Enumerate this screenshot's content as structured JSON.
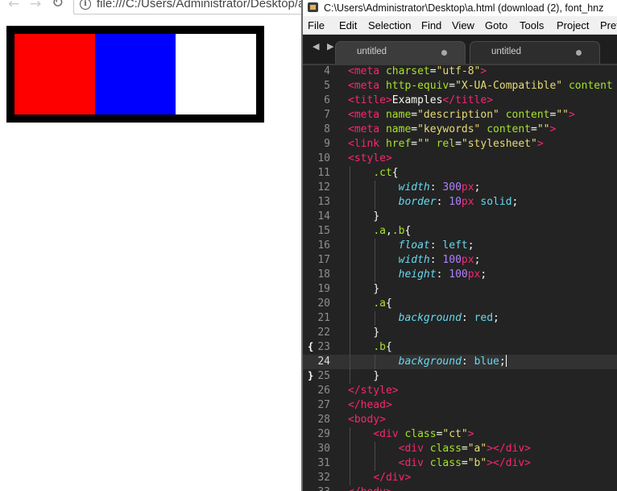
{
  "browser": {
    "address": "file:///C:/Users/Administrator/Desktop/a.html",
    "demo_colors": {
      "a": "#ff0000",
      "b": "#0000ff",
      "border": "#000000"
    }
  },
  "editor": {
    "title": "C:\\Users\\Administrator\\Desktop\\a.html (download (2), font_hnz",
    "menu": [
      "File",
      "Edit",
      "Selection",
      "Find",
      "View",
      "Goto",
      "Tools",
      "Project",
      "Pref"
    ],
    "tabs": [
      "untitled",
      "untitled"
    ],
    "current_line": 24,
    "lines": [
      {
        "n": 4,
        "indent": 0,
        "tokens": [
          [
            "tag",
            "<meta "
          ],
          [
            "attr",
            "charset"
          ],
          [
            "plain",
            "="
          ],
          [
            "str",
            "\"utf-8\""
          ],
          [
            "tag",
            ">"
          ]
        ]
      },
      {
        "n": 5,
        "indent": 0,
        "tokens": [
          [
            "tag",
            "<meta "
          ],
          [
            "attr",
            "http-equiv"
          ],
          [
            "plain",
            "="
          ],
          [
            "str",
            "\"X-UA-Compatible\""
          ],
          [
            "plain",
            " "
          ],
          [
            "attr",
            "content"
          ]
        ]
      },
      {
        "n": 6,
        "indent": 0,
        "tokens": [
          [
            "tag",
            "<title>"
          ],
          [
            "plain",
            "Examples"
          ],
          [
            "tag",
            "</title>"
          ]
        ]
      },
      {
        "n": 7,
        "indent": 0,
        "tokens": [
          [
            "tag",
            "<meta "
          ],
          [
            "attr",
            "name"
          ],
          [
            "plain",
            "="
          ],
          [
            "str",
            "\"description\""
          ],
          [
            "plain",
            " "
          ],
          [
            "attr",
            "content"
          ],
          [
            "plain",
            "="
          ],
          [
            "str",
            "\"\""
          ],
          [
            "tag",
            ">"
          ]
        ]
      },
      {
        "n": 8,
        "indent": 0,
        "tokens": [
          [
            "tag",
            "<meta "
          ],
          [
            "attr",
            "name"
          ],
          [
            "plain",
            "="
          ],
          [
            "str",
            "\"keywords\""
          ],
          [
            "plain",
            " "
          ],
          [
            "attr",
            "content"
          ],
          [
            "plain",
            "="
          ],
          [
            "str",
            "\"\""
          ],
          [
            "tag",
            ">"
          ]
        ]
      },
      {
        "n": 9,
        "indent": 0,
        "tokens": [
          [
            "tag",
            "<link "
          ],
          [
            "attr",
            "href"
          ],
          [
            "plain",
            "="
          ],
          [
            "str",
            "\"\""
          ],
          [
            "plain",
            " "
          ],
          [
            "attr",
            "rel"
          ],
          [
            "plain",
            "="
          ],
          [
            "str",
            "\"stylesheet\""
          ],
          [
            "tag",
            ">"
          ]
        ]
      },
      {
        "n": 10,
        "indent": 0,
        "tokens": [
          [
            "tag",
            "<style>"
          ]
        ]
      },
      {
        "n": 11,
        "indent": 1,
        "tokens": [
          [
            "sel",
            ".ct"
          ],
          [
            "plain",
            "{"
          ]
        ]
      },
      {
        "n": 12,
        "indent": 2,
        "tokens": [
          [
            "prop",
            "width"
          ],
          [
            "plain",
            ": "
          ],
          [
            "num",
            "300"
          ],
          [
            "tag",
            "px"
          ],
          [
            "plain",
            ";"
          ]
        ]
      },
      {
        "n": 13,
        "indent": 2,
        "tokens": [
          [
            "prop",
            "border"
          ],
          [
            "plain",
            ": "
          ],
          [
            "num",
            "10"
          ],
          [
            "tag",
            "px"
          ],
          [
            "plain",
            " "
          ],
          [
            "kw",
            "solid"
          ],
          [
            "plain",
            ";"
          ]
        ]
      },
      {
        "n": 14,
        "indent": 1,
        "tokens": [
          [
            "plain",
            "}"
          ]
        ]
      },
      {
        "n": 15,
        "indent": 1,
        "tokens": [
          [
            "sel",
            ".a"
          ],
          [
            "plain",
            ","
          ],
          [
            "sel",
            ".b"
          ],
          [
            "plain",
            "{"
          ]
        ]
      },
      {
        "n": 16,
        "indent": 2,
        "tokens": [
          [
            "prop",
            "float"
          ],
          [
            "plain",
            ": "
          ],
          [
            "kw",
            "left"
          ],
          [
            "plain",
            ";"
          ]
        ]
      },
      {
        "n": 17,
        "indent": 2,
        "tokens": [
          [
            "prop",
            "width"
          ],
          [
            "plain",
            ": "
          ],
          [
            "num",
            "100"
          ],
          [
            "tag",
            "px"
          ],
          [
            "plain",
            ";"
          ]
        ]
      },
      {
        "n": 18,
        "indent": 2,
        "tokens": [
          [
            "prop",
            "height"
          ],
          [
            "plain",
            ": "
          ],
          [
            "num",
            "100"
          ],
          [
            "tag",
            "px"
          ],
          [
            "plain",
            ";"
          ]
        ]
      },
      {
        "n": 19,
        "indent": 1,
        "tokens": [
          [
            "plain",
            "}"
          ]
        ]
      },
      {
        "n": 20,
        "indent": 1,
        "tokens": [
          [
            "sel",
            ".a"
          ],
          [
            "plain",
            "{"
          ]
        ]
      },
      {
        "n": 21,
        "indent": 2,
        "tokens": [
          [
            "prop",
            "background"
          ],
          [
            "plain",
            ": "
          ],
          [
            "kw",
            "red"
          ],
          [
            "plain",
            ";"
          ]
        ]
      },
      {
        "n": 22,
        "indent": 1,
        "tokens": [
          [
            "plain",
            "}"
          ]
        ]
      },
      {
        "n": 23,
        "indent": 1,
        "fold": "{",
        "tokens": [
          [
            "sel",
            ".b"
          ],
          [
            "plain",
            "{"
          ]
        ]
      },
      {
        "n": 24,
        "indent": 2,
        "cursor": true,
        "tokens": [
          [
            "prop",
            "background"
          ],
          [
            "plain",
            ": "
          ],
          [
            "kw",
            "blue"
          ],
          [
            "plain",
            ";"
          ]
        ]
      },
      {
        "n": 25,
        "indent": 1,
        "fold": "}",
        "tokens": [
          [
            "plain",
            "}"
          ]
        ]
      },
      {
        "n": 26,
        "indent": 0,
        "tokens": [
          [
            "tag",
            "</style>"
          ]
        ]
      },
      {
        "n": 27,
        "indent": 0,
        "tokens": [
          [
            "tag",
            "</head>"
          ]
        ]
      },
      {
        "n": 28,
        "indent": 0,
        "tokens": [
          [
            "tag",
            "<body>"
          ]
        ]
      },
      {
        "n": 29,
        "indent": 1,
        "tokens": [
          [
            "tag",
            "<div "
          ],
          [
            "attr",
            "class"
          ],
          [
            "plain",
            "="
          ],
          [
            "str",
            "\"ct\""
          ],
          [
            "tag",
            ">"
          ]
        ]
      },
      {
        "n": 30,
        "indent": 2,
        "tokens": [
          [
            "tag",
            "<div "
          ],
          [
            "attr",
            "class"
          ],
          [
            "plain",
            "="
          ],
          [
            "str",
            "\"a\""
          ],
          [
            "tag",
            "></div>"
          ]
        ]
      },
      {
        "n": 31,
        "indent": 2,
        "tokens": [
          [
            "tag",
            "<div "
          ],
          [
            "attr",
            "class"
          ],
          [
            "plain",
            "="
          ],
          [
            "str",
            "\"b\""
          ],
          [
            "tag",
            "></div>"
          ]
        ]
      },
      {
        "n": 32,
        "indent": 1,
        "tokens": [
          [
            "tag",
            "</div>"
          ]
        ]
      },
      {
        "n": 33,
        "indent": 0,
        "tokens": [
          [
            "tag",
            "</body>"
          ]
        ]
      }
    ]
  }
}
